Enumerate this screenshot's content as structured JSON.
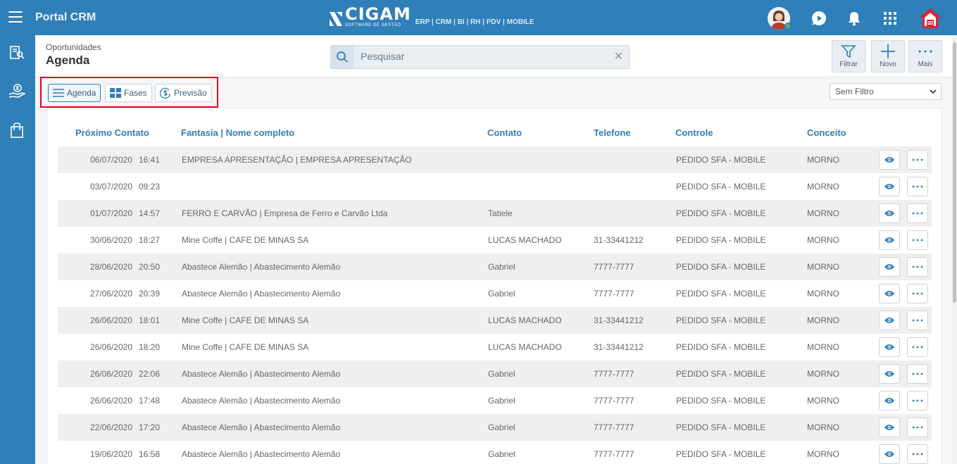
{
  "topbar": {
    "app_title": "Portal CRM",
    "logo_name": "CIGAM",
    "logo_sub": "SOFTWARE DE GESTÃO",
    "logo_modules": "ERP | CRM | BI | RH | PDV | MOBILE",
    "icons": [
      "menu-icon",
      "avatar",
      "play-icon",
      "bell-icon",
      "apps-grid-icon",
      "home-icon"
    ]
  },
  "sidebar": {
    "items": [
      "contacts-icon",
      "money-hand-icon",
      "shopping-bag-icon"
    ]
  },
  "header": {
    "breadcrumb": "Oportunidades",
    "title": "Agenda",
    "search_placeholder": "Pesquisar",
    "actions": {
      "filter": "Filtrar",
      "new": "Novo",
      "more": "Mais"
    }
  },
  "toolbar": {
    "views": [
      {
        "label": "Agenda",
        "icon": "list-icon",
        "active": true
      },
      {
        "label": "Fases",
        "icon": "grid-icon",
        "active": false
      },
      {
        "label": "Previsão",
        "icon": "dollar-circle-icon",
        "active": false
      }
    ],
    "filter_value": "Sem Filtro"
  },
  "table": {
    "columns": [
      "Próximo Contato",
      "Fantasia | Nome completo",
      "Contato",
      "Telefone",
      "Controle",
      "Conceito"
    ],
    "rows": [
      {
        "date": "06/07/2020",
        "time": "16:41",
        "name": "EMPRESA APRESENTAÇÃO | EMPRESA APRESENTAÇÃO",
        "contact": "",
        "phone": "",
        "control": "PEDIDO SFA - MOBILE",
        "concept": "MORNO"
      },
      {
        "date": "03/07/2020",
        "time": "09:23",
        "name": "",
        "contact": "",
        "phone": "",
        "control": "PEDIDO SFA - MOBILE",
        "concept": "MORNO"
      },
      {
        "date": "01/07/2020",
        "time": "14:57",
        "name": "FERRO E CARVÃO | Empresa de Ferro e Carvão Ltda",
        "contact": "Tatiele",
        "phone": "",
        "control": "PEDIDO SFA - MOBILE",
        "concept": "MORNO"
      },
      {
        "date": "30/06/2020",
        "time": "18:27",
        "name": "Mine Coffe | CAFE DE MINAS SA",
        "contact": "LUCAS MACHADO",
        "phone": "31-33441212",
        "control": "PEDIDO SFA - MOBILE",
        "concept": "MORNO"
      },
      {
        "date": "28/06/2020",
        "time": "20:50",
        "name": "Abastece Alemão | Abastecimento Alemão",
        "contact": "Gabriel",
        "phone": "7777-7777",
        "control": "PEDIDO SFA - MOBILE",
        "concept": "MORNO"
      },
      {
        "date": "27/06/2020",
        "time": "20:39",
        "name": "Abastece Alemão | Abastecimento Alemão",
        "contact": "Gabriel",
        "phone": "7777-7777",
        "control": "PEDIDO SFA - MOBILE",
        "concept": "MORNO"
      },
      {
        "date": "26/06/2020",
        "time": "18:01",
        "name": "Mine Coffe | CAFE DE MINAS SA",
        "contact": "LUCAS MACHADO",
        "phone": "31-33441212",
        "control": "PEDIDO SFA - MOBILE",
        "concept": "MORNO"
      },
      {
        "date": "26/06/2020",
        "time": "18:20",
        "name": "Mine Coffe | CAFE DE MINAS SA",
        "contact": "LUCAS MACHADO",
        "phone": "31-33441212",
        "control": "PEDIDO SFA - MOBILE",
        "concept": "MORNO"
      },
      {
        "date": "26/06/2020",
        "time": "22:06",
        "name": "Abastece Alemão | Abastecimento Alemão",
        "contact": "Gabriel",
        "phone": "7777-7777",
        "control": "PEDIDO SFA - MOBILE",
        "concept": "MORNO"
      },
      {
        "date": "26/06/2020",
        "time": "17:48",
        "name": "Abastece Alemão | Abastecimento Alemão",
        "contact": "Gabriel",
        "phone": "7777-7777",
        "control": "PEDIDO SFA - MOBILE",
        "concept": "MORNO"
      },
      {
        "date": "22/06/2020",
        "time": "17:20",
        "name": "Abastece Alemão | Abastecimento Alemão",
        "contact": "Gabriel",
        "phone": "7777-7777",
        "control": "PEDIDO SFA - MOBILE",
        "concept": "MORNO"
      },
      {
        "date": "19/06/2020",
        "time": "16:58",
        "name": "Abastece Alemão | Abastecimento Alemão",
        "contact": "Gabriel",
        "phone": "7777-7777",
        "control": "PEDIDO SFA - MOBILE",
        "concept": "MORNO"
      }
    ]
  },
  "colors": {
    "brand": "#2f7fb8",
    "highlight": "#e4001b",
    "home_icon": "#d9262b"
  }
}
